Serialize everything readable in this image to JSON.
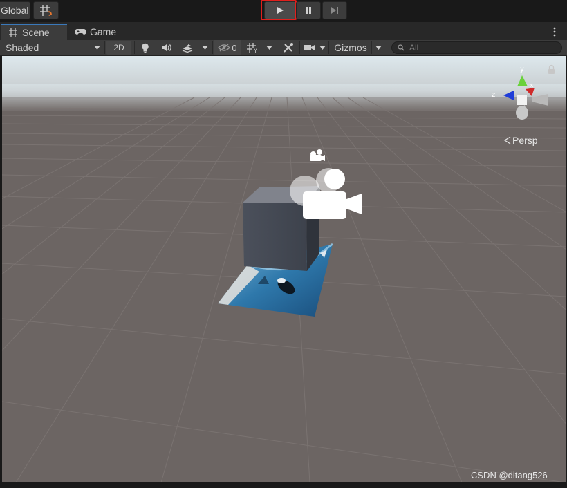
{
  "toolbar": {
    "global_label": "Global",
    "play_icon": "play-icon",
    "pause_icon": "pause-icon",
    "step_icon": "step-icon"
  },
  "tabs": {
    "scene_label": "Scene",
    "game_label": "Game"
  },
  "scene_toolbar": {
    "shading_mode": "Shaded",
    "mode_2d": "2D",
    "hidden_count": "0",
    "gizmos_label": "Gizmos",
    "search_placeholder": "All"
  },
  "viewport": {
    "projection_label": "Persp",
    "gizmo_axes": {
      "y": "y",
      "z": "z",
      "x": "x"
    }
  },
  "colors": {
    "play_highlight": "#e0201d",
    "tab_accent": "#3a79bb",
    "ground": "#6c6563",
    "sky": "#dfe9ee",
    "cube_front": "#454a56",
    "cube_top": "#80838c"
  },
  "watermark": "CSDN @ditang526"
}
